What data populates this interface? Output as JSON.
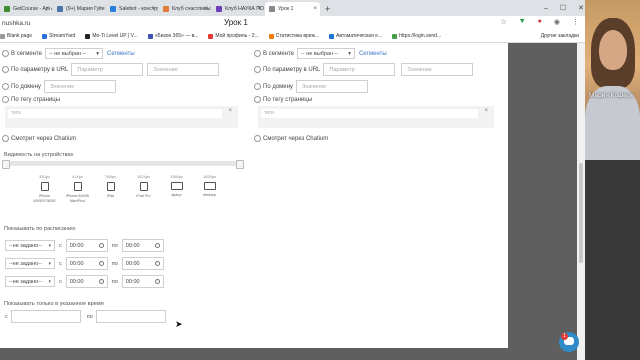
{
  "browser": {
    "tabs": [
      {
        "label": "GetCourse - Api Accoun",
        "favicon_color": "#3c8d2f"
      },
      {
        "label": "(9+) Мария Гусева | В",
        "favicon_color": "#4a76a8"
      },
      {
        "label": "Salebot - конструктор",
        "favicon_color": "#2a7de1"
      },
      {
        "label": "Клуб счастливых жен",
        "favicon_color": "#e07b39"
      },
      {
        "label": "Клуб НАУКА ПОБЕЖД",
        "favicon_color": "#6a3fb5"
      },
      {
        "label": "Урок 1",
        "favicon_color": "#888888",
        "active": true
      }
    ],
    "new_tab": "+",
    "window_controls": [
      "–",
      "☐",
      "✕"
    ],
    "url": "nushka.ru",
    "page_title": "Урок 1",
    "bookmarks": [
      {
        "label": "Blank page",
        "color": "#999999"
      },
      {
        "label": "StreamYard",
        "color": "#2f6fdb"
      },
      {
        "label": "Mo-Ti Level UP | V...",
        "color": "#222222"
      },
      {
        "label": "«Бизон 365» — в...",
        "color": "#3f51b5"
      },
      {
        "label": "Мой профиль - 2...",
        "color": "#e53935"
      },
      {
        "label": "Статистика вреж...",
        "color": "#f57c00"
      },
      {
        "label": "Автоматическая е...",
        "color": "#1976d2"
      },
      {
        "label": "https://login.send...",
        "color": "#43a047"
      }
    ],
    "other_bookmarks": "Другие закладки"
  },
  "left_col": {
    "segment_label": "В сегменте",
    "segment_value": "-- не выбран --",
    "segments_link": "Сегменты",
    "url_param_label": "По параметру в URL",
    "param_placeholder": "Параметр",
    "value_placeholder": "Значение",
    "domain_label": "По домену",
    "domain_placeholder": "Значение",
    "page_tag_label": "По тегу страницы",
    "tags_placeholder": "теги",
    "tag_clear": "×",
    "chatium_label": "Смотрит через Chatium"
  },
  "right_col": {
    "segment_label": "В сегменте",
    "segment_value": "-- не выбран --",
    "segments_link": "Сегменты",
    "url_param_label": "По параметру в URL",
    "param_placeholder": "Параметр",
    "value_placeholder": "Значение",
    "domain_label": "По домену",
    "domain_placeholder": "Значение",
    "page_tag_label": "По тегу страницы",
    "tags_placeholder": "теги",
    "tag_clear": "×",
    "chatium_label": "Смотрит через Chatium"
  },
  "visibility": {
    "label": "Видимость на устройствах",
    "devices": [
      {
        "res": "320px",
        "name": "iPhone 4/5/5S/7/8/SE",
        "icon": "phone-icon"
      },
      {
        "res": "414px",
        "name": "iPhone 6/6/8S Max/Plus",
        "icon": "phone-icon"
      },
      {
        "res": "768px",
        "name": "iPad",
        "icon": "tablet-icon"
      },
      {
        "res": "1024px",
        "name": "iPad Pro",
        "icon": "tablet-icon"
      },
      {
        "res": "1280px",
        "name": "laptop",
        "icon": "laptop-icon"
      },
      {
        "res": "1920px",
        "name": "desktop",
        "icon": "desktop-icon"
      }
    ]
  },
  "schedule": {
    "label": "Показывать по расписанию",
    "rows": [
      {
        "day": "--не задано--",
        "from_label": "с",
        "from": "00:00",
        "to_label": "по",
        "to": "00:00"
      },
      {
        "day": "--не задано--",
        "from_label": "с",
        "from": "00:00",
        "to_label": "по",
        "to": "00:00"
      },
      {
        "day": "--не задано--",
        "from_label": "с",
        "from": "00:00",
        "to_label": "по",
        "to": "00:00"
      }
    ]
  },
  "time_window": {
    "label": "Показывать только в указанное время",
    "from_label": "с",
    "to_label": "по"
  },
  "webcam": {
    "name": "Мария Кошеле"
  },
  "chat": {
    "badge": "1"
  }
}
